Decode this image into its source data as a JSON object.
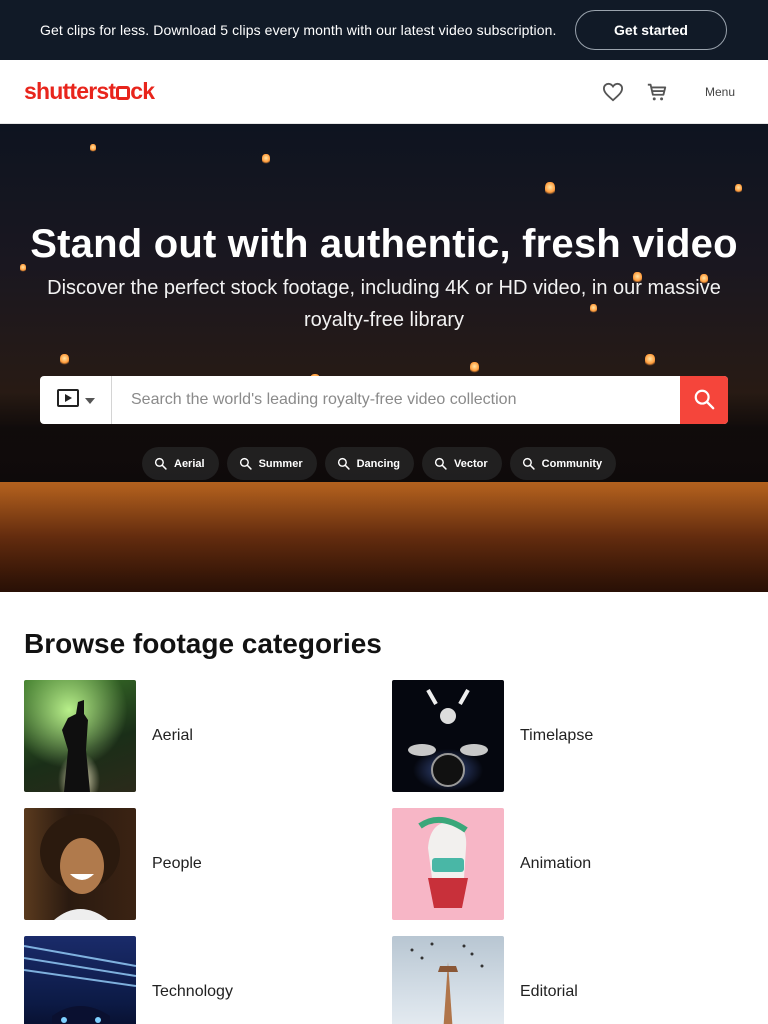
{
  "promo": {
    "text": "Get clips for less. Download 5 clips every month with our latest video subscription.",
    "button": "Get started"
  },
  "header": {
    "logo_pre": "shutterst",
    "logo_post": "ck",
    "menu_label": "Menu"
  },
  "hero": {
    "title": "Stand out with authentic, fresh video",
    "subtitle": "Discover the perfect stock footage, including 4K or HD video, in our massive royalty-free library",
    "search_placeholder": "Search the world's leading royalty-free video collection",
    "chips": [
      "Aerial",
      "Summer",
      "Dancing",
      "Vector",
      "Community"
    ]
  },
  "categories": {
    "title": "Browse footage categories",
    "items": [
      "Aerial",
      "Timelapse",
      "People",
      "Animation",
      "Technology",
      "Editorial"
    ]
  },
  "colors": {
    "brand_red": "#e8251c",
    "search_button": "#f5453b",
    "promo_bg": "#111a27"
  }
}
